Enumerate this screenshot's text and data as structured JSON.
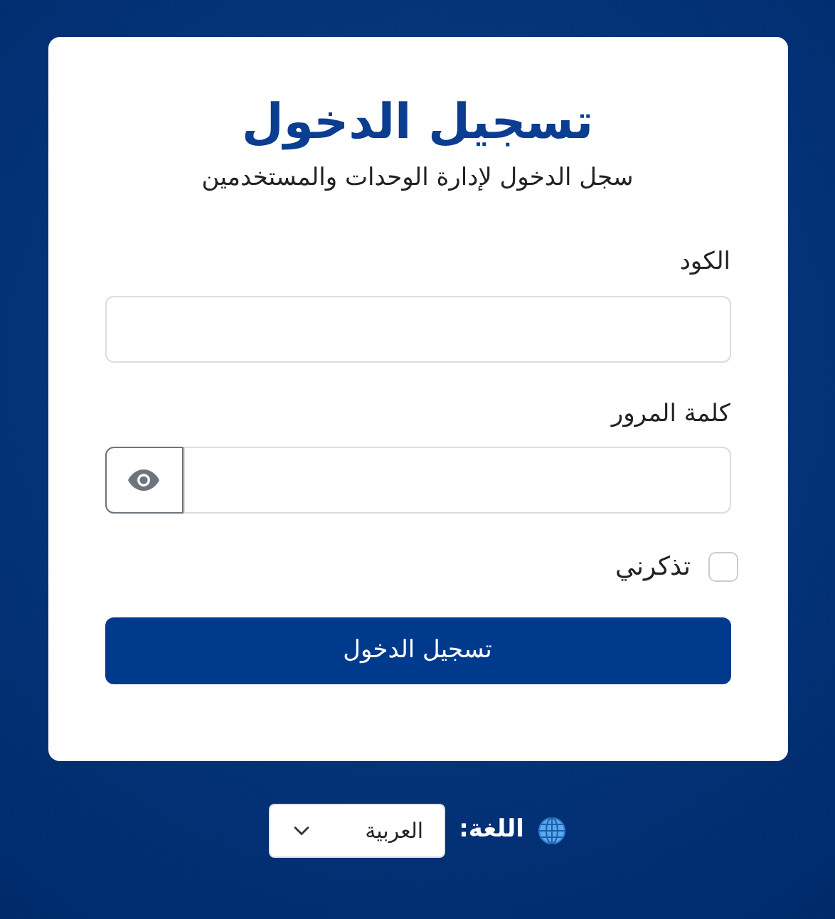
{
  "login_card": {
    "title": "تسجيل الدخول",
    "subtitle": "سجل الدخول لإدارة الوحدات والمستخدمين",
    "fields": [
      {
        "kind": "text",
        "label": "الكود"
      },
      {
        "kind": "password",
        "label": "كلمة المرور"
      }
    ],
    "remember_me": {
      "label": "تذكرني",
      "checked": false
    },
    "submit_button": "تسجيل الدخول"
  },
  "language": {
    "label": "اللغة:",
    "value": "العربية"
  }
}
